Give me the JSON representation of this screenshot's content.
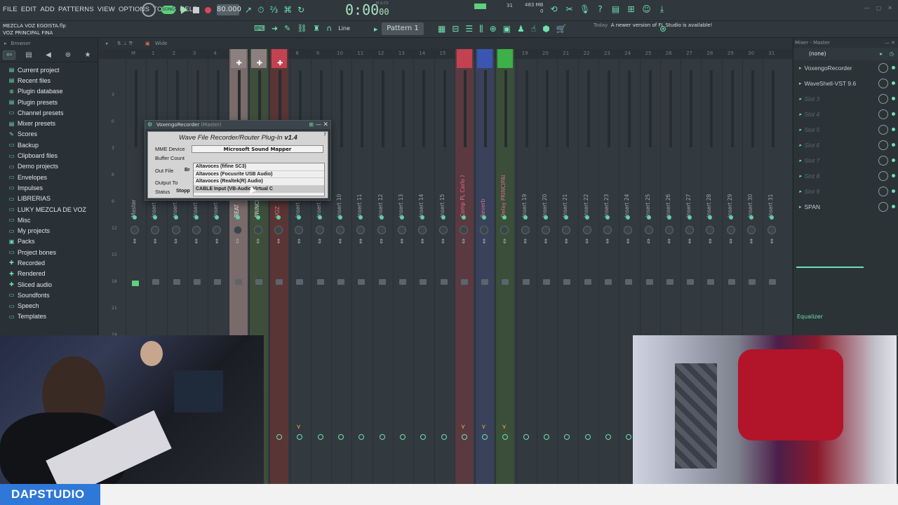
{
  "menu": [
    "FILE",
    "EDIT",
    "ADD",
    "PATTERNS",
    "VIEW",
    "OPTIONS",
    "TOOLS",
    "HELP"
  ],
  "transport": {
    "song_label": "SONG",
    "tempo": "80.000",
    "time": "0:00",
    "time_fraction": "00",
    "time_unit": "M:S:CS"
  },
  "cpu": {
    "value": "31",
    "memory": "483 MB",
    "polyphony": "0"
  },
  "project": {
    "file": "MEZCLA VOZ EGOISTA.flp",
    "name": "VOZ PRINCIPAL FINA"
  },
  "toolbar": {
    "snap_label": "Line",
    "pattern_label": "Pattern 1"
  },
  "news": {
    "today": "Today",
    "message": "A newer version of FL Studio is available!"
  },
  "browser": {
    "title": "Browser",
    "items": [
      {
        "label": "Current project",
        "icon": "project-icon"
      },
      {
        "label": "Recent files",
        "icon": "recent-icon"
      },
      {
        "label": "Plugin database",
        "icon": "plugin-db-icon"
      },
      {
        "label": "Plugin presets",
        "icon": "preset-icon"
      },
      {
        "label": "Channel presets",
        "icon": "folder-icon"
      },
      {
        "label": "Mixer presets",
        "icon": "mixer-icon"
      },
      {
        "label": "Scores",
        "icon": "score-icon"
      },
      {
        "label": "Backup",
        "icon": "folder-icon"
      },
      {
        "label": "Clipboard files",
        "icon": "folder-icon"
      },
      {
        "label": "Demo projects",
        "icon": "folder-icon"
      },
      {
        "label": "Envelopes",
        "icon": "folder-icon"
      },
      {
        "label": "Impulses",
        "icon": "folder-icon"
      },
      {
        "label": "LIBRERIAS",
        "icon": "folder-icon"
      },
      {
        "label": "LUKY MEZCLA DE VOZ",
        "icon": "folder-icon"
      },
      {
        "label": "Misc",
        "icon": "folder-icon"
      },
      {
        "label": "My projects",
        "icon": "folder-icon"
      },
      {
        "label": "Packs",
        "icon": "packs-icon"
      },
      {
        "label": "Project bones",
        "icon": "folder-icon"
      },
      {
        "label": "Recorded",
        "icon": "recorded-icon"
      },
      {
        "label": "Rendered",
        "icon": "rendered-icon"
      },
      {
        "label": "Sliced audio",
        "icon": "sliced-icon"
      },
      {
        "label": "Soundfonts",
        "icon": "folder-icon"
      },
      {
        "label": "Speech",
        "icon": "speech-icon"
      },
      {
        "label": "Templates",
        "icon": "folder-icon"
      }
    ]
  },
  "mixer": {
    "view_label": "Wide",
    "ruler": [
      "M",
      "1",
      "2",
      "3",
      "4",
      "5",
      "6",
      "7",
      "8",
      "9",
      "10",
      "11",
      "12",
      "13",
      "14",
      "15",
      "16",
      "17",
      "18",
      "19",
      "20",
      "21",
      "22",
      "23",
      "24",
      "25",
      "26",
      "27",
      "28",
      "29",
      "30",
      "31"
    ],
    "scale": [
      "3",
      "0",
      "3",
      "6",
      "9",
      "12",
      "15",
      "18",
      "21",
      "24"
    ],
    "strips": [
      {
        "name": "Master",
        "color": ""
      },
      {
        "name": "Insert 1",
        "color": ""
      },
      {
        "name": "Insert 2",
        "color": ""
      },
      {
        "name": "Insert 3",
        "color": ""
      },
      {
        "name": "Insert 4",
        "color": ""
      },
      {
        "name": "BEAT",
        "color": "#7a6a6a"
      },
      {
        "name": "PRINCIPAL",
        "color": "#3f4e3a"
      },
      {
        "name": "VOZ",
        "color": "#5a3535"
      },
      {
        "name": "Insert 8",
        "color": ""
      },
      {
        "name": "Insert 9",
        "color": ""
      },
      {
        "name": "Insert 10",
        "color": ""
      },
      {
        "name": "Insert 11",
        "color": ""
      },
      {
        "name": "Insert 12",
        "color": ""
      },
      {
        "name": "Insert 13",
        "color": ""
      },
      {
        "name": "Insert 14",
        "color": ""
      },
      {
        "name": "Insert 15",
        "color": ""
      },
      {
        "name": "Comp PL Carlo X",
        "color": "#5a3a40"
      },
      {
        "name": "Reverb",
        "color": "#39425a"
      },
      {
        "name": "Delay PRINCIPAL",
        "color": "#3a4e3a"
      },
      {
        "name": "Insert 19",
        "color": ""
      },
      {
        "name": "Insert 20",
        "color": ""
      },
      {
        "name": "Insert 21",
        "color": ""
      },
      {
        "name": "Insert 22",
        "color": ""
      },
      {
        "name": "Insert 23",
        "color": ""
      },
      {
        "name": "Insert 24",
        "color": ""
      },
      {
        "name": "Insert 25",
        "color": ""
      },
      {
        "name": "Insert 26",
        "color": ""
      },
      {
        "name": "Insert 27",
        "color": ""
      },
      {
        "name": "Insert 28",
        "color": ""
      },
      {
        "name": "Insert 29",
        "color": ""
      },
      {
        "name": "Insert 30",
        "color": ""
      },
      {
        "name": "Insert 31",
        "color": ""
      }
    ]
  },
  "plugin": {
    "title": "VoxengoRecorder",
    "target": "(Master)",
    "heading": "Wave File Recorder/Router Plug-In",
    "version": "v1.4",
    "labels": {
      "device": "MME Device",
      "buffer": "Buffer Count",
      "outfile": "Out File",
      "output": "Output To",
      "status": "Status"
    },
    "selected_device": "Microsoft Sound Mapper",
    "outfile_value": "Br",
    "status_value": "Stopp",
    "dropdown": [
      "Altavoces (fifine SC3)",
      "Altavoces (Focusrite USB Audio)",
      "Altavoces (Realtek(R) Audio)",
      "CABLE Input (VB-Audio Virtual C"
    ]
  },
  "rpanel": {
    "title": "Mixer - Master",
    "preset": "(none)",
    "slots": [
      {
        "label": "VoxengoRecorder",
        "empty": false
      },
      {
        "label": "WaveShell-VST 9.6",
        "empty": false
      },
      {
        "label": "Slot 3",
        "empty": true
      },
      {
        "label": "Slot 4",
        "empty": true
      },
      {
        "label": "Slot 5",
        "empty": true
      },
      {
        "label": "Slot 6",
        "empty": true
      },
      {
        "label": "Slot 7",
        "empty": true
      },
      {
        "label": "Slot 8",
        "empty": true
      },
      {
        "label": "Slot 9",
        "empty": true
      },
      {
        "label": "SPAN",
        "empty": false
      }
    ],
    "eq_label": "Equalizer"
  },
  "brand": "DAPSTUDIO"
}
